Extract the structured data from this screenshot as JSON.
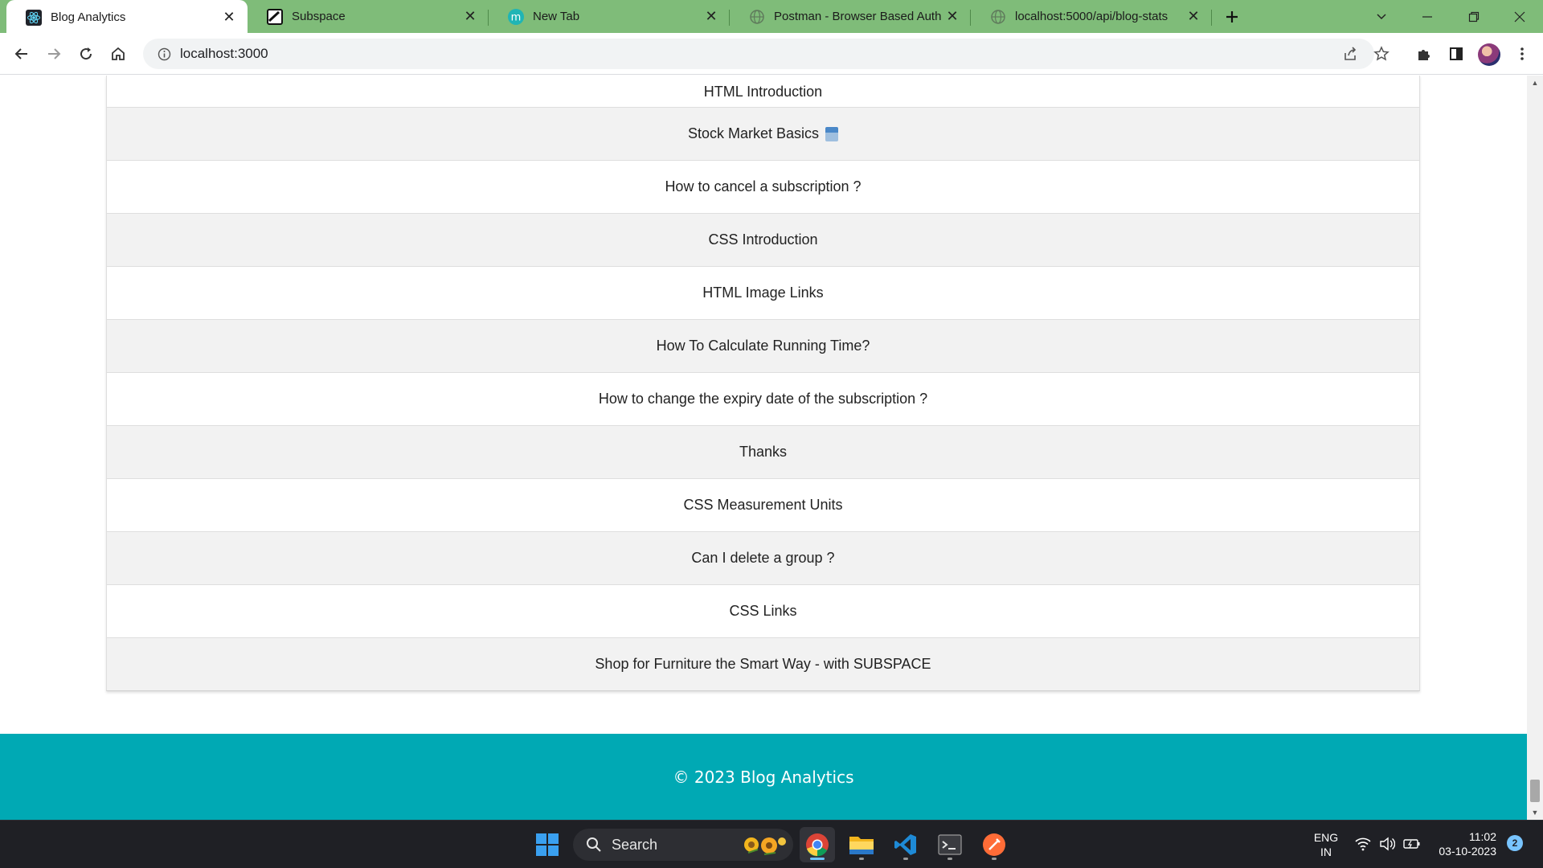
{
  "browser": {
    "tabs": [
      {
        "label": "Blog Analytics",
        "icon": "react-icon",
        "active": true
      },
      {
        "label": "Subspace",
        "icon": "subspace-icon",
        "active": false
      },
      {
        "label": "New Tab",
        "icon": "m-icon",
        "active": false
      },
      {
        "label": "Postman - Browser Based Auth",
        "icon": "globe-icon",
        "active": false
      },
      {
        "label": "localhost:5000/api/blog-stats",
        "icon": "globe-icon",
        "active": false
      }
    ],
    "url": "localhost:3000"
  },
  "page": {
    "blog_titles": [
      "HTML Introduction",
      "Stock Market Basics",
      "How to cancel a subscription ?",
      "CSS Introduction",
      "HTML Image Links",
      "How To Calculate Running Time?",
      "How to change the expiry date of the subscription ?",
      "Thanks",
      "CSS Measurement Units",
      "Can I delete a group ?",
      "CSS Links",
      "Shop for Furniture the Smart Way - with SUBSPACE"
    ],
    "footer": "© 2023 Blog Analytics"
  },
  "taskbar": {
    "search_label": "Search",
    "language": "ENG",
    "region": "IN",
    "time": "11:02",
    "date": "03-10-2023",
    "notification_count": "2"
  }
}
